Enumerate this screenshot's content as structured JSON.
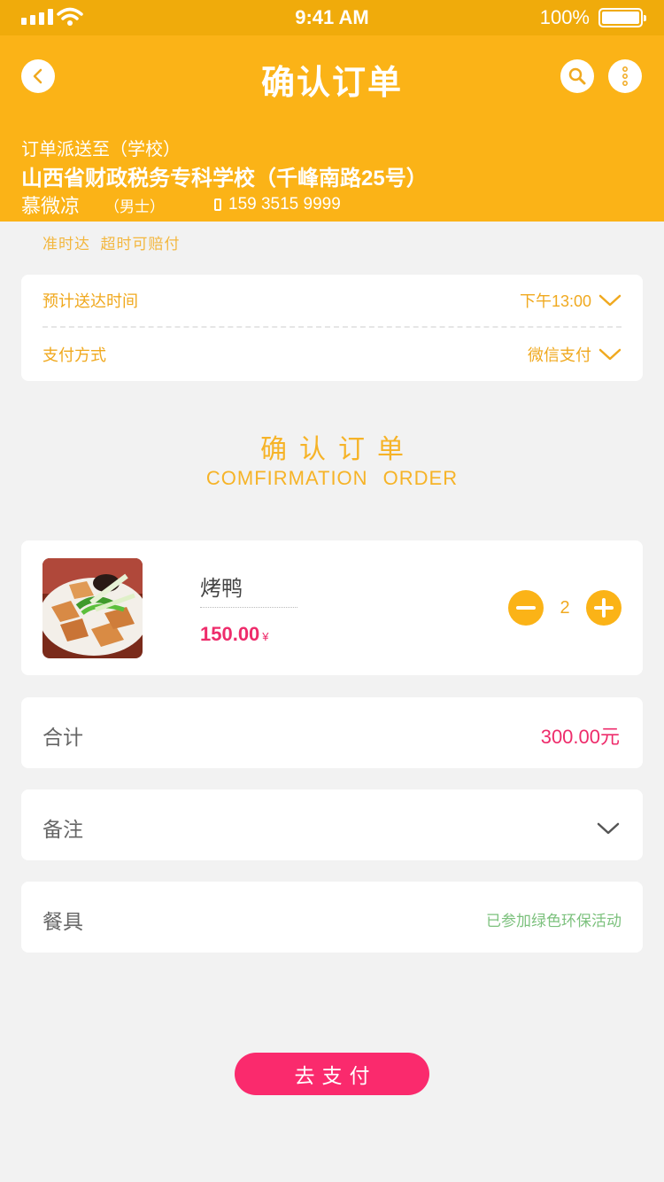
{
  "status_bar": {
    "time": "9:41 AM",
    "battery": "100%"
  },
  "header": {
    "title": "确认订单",
    "deliver_label": "订单派送至（学校）",
    "address": "山西省财政税务专科学校（千峰南路25号）",
    "receiver_name": "慕微凉",
    "receiver_gender": "（男士）",
    "receiver_phone": "159 3515 9999"
  },
  "ontime_notice": "准时达  超时可赔付",
  "options": {
    "time_label": "预计送达时间",
    "time_value": "下午13:00",
    "pay_label": "支付方式",
    "pay_value": "微信支付"
  },
  "section": {
    "title_cn": "确认订单",
    "title_en": "COMFIRMATION ORDER"
  },
  "item": {
    "name": "烤鸭",
    "price": "150.00",
    "currency": "¥",
    "quantity": "2"
  },
  "total": {
    "label": "合计",
    "value": "300.00元"
  },
  "remark": {
    "label": "备注"
  },
  "tableware": {
    "label": "餐具",
    "value": "已参加绿色环保活动"
  },
  "pay_button": {
    "label": "去支付"
  },
  "colors": {
    "primary": "#fbb317",
    "status_bar": "#f0ab0b",
    "accent_pink": "#fa2a6d",
    "price": "#ee2c6b",
    "green": "#7cc17d"
  },
  "icons": [
    "signal-icon",
    "wifi-icon",
    "battery-icon",
    "back-icon",
    "search-icon",
    "more-icon",
    "phone-icon",
    "chevron-down-icon",
    "minus-icon",
    "plus-icon"
  ]
}
